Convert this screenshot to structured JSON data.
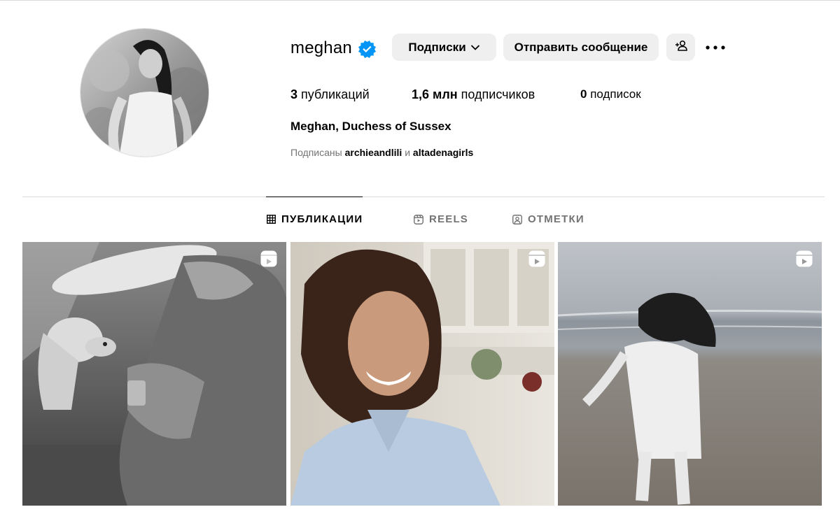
{
  "profile": {
    "username": "meghan",
    "verified": true,
    "full_name": "Meghan, Duchess of Sussex",
    "avatar_icon": "profile-photo"
  },
  "actions": {
    "following_label": "Подписки",
    "message_label": "Отправить сообщение",
    "add_person_icon": "add-person-icon",
    "more_icon": "more-options-icon"
  },
  "stats": {
    "posts_count": "3",
    "posts_label": "публикаций",
    "followers_count": "1,6 млн",
    "followers_label": "подписчиков",
    "following_count": "0",
    "following_label": "подписок"
  },
  "followed_by": {
    "prefix": "Подписаны",
    "user1": "archieandlili",
    "conjunction": "и",
    "user2": "altadenagirls"
  },
  "tabs": [
    {
      "label": "ПУБЛИКАЦИИ",
      "icon": "grid-icon",
      "active": true
    },
    {
      "label": "REELS",
      "icon": "reels-icon",
      "active": false
    },
    {
      "label": "ОТМЕТКИ",
      "icon": "tagged-icon",
      "active": false
    }
  ],
  "posts": [
    {
      "description_icon": "woman-with-dog-photo",
      "type": "reel"
    },
    {
      "description_icon": "smiling-woman-photo",
      "type": "reel"
    },
    {
      "description_icon": "beach-running-photo",
      "type": "reel"
    }
  ],
  "colors": {
    "verified_blue": "#0095f6",
    "button_bg": "#efefef",
    "secondary_text": "#737373",
    "divider": "#dbdbdb"
  }
}
